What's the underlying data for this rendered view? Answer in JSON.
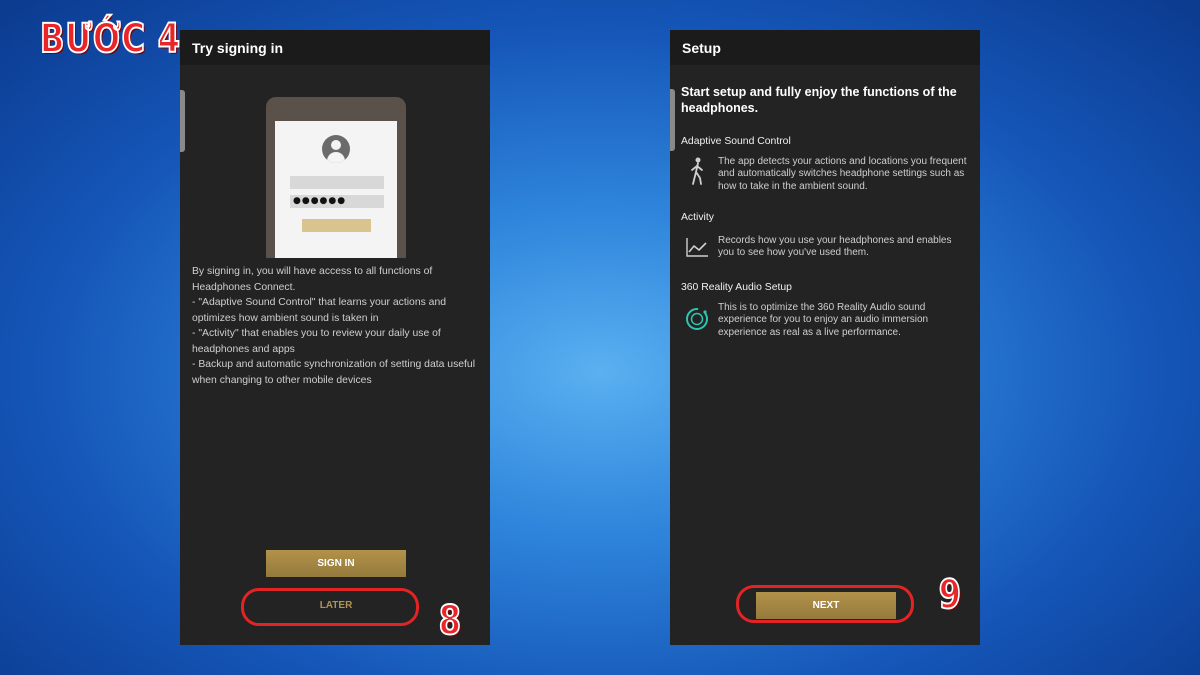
{
  "step_label": "BƯỚC 4",
  "badges": {
    "left": "8",
    "right": "9"
  },
  "left_screen": {
    "title": "Try signing in",
    "password_mask": "●●●●●●",
    "description": [
      "By signing in, you will have access to all functions of Headphones Connect.",
      "- \"Adaptive Sound Control\" that learns your actions and optimizes how ambient sound is taken in",
      "- \"Activity\" that enables you to review your daily use of headphones and apps",
      "- Backup and automatic synchronization of setting data useful when changing to other mobile devices"
    ],
    "sign_in_label": "SIGN IN",
    "later_label": "LATER"
  },
  "right_screen": {
    "title": "Setup",
    "heading": "Start setup and fully enjoy the functions of the headphones.",
    "sections": [
      {
        "title": "Adaptive Sound Control",
        "icon": "walking-person-icon",
        "text": "The app detects your actions and locations you frequent and automatically switches headphone settings such as how to take in the ambient sound."
      },
      {
        "title": "Activity",
        "icon": "line-chart-icon",
        "text": "Records how you use your headphones and enables you to see how you've used them."
      },
      {
        "title": "360 Reality Audio Setup",
        "icon": "360-audio-icon",
        "text": "This is to optimize the 360 Reality Audio sound experience for you to enjoy an audio immersion experience as real as a live performance."
      }
    ],
    "next_label": "NEXT"
  },
  "colors": {
    "accent_gold": "#a88a46",
    "highlight_red": "#e32424",
    "panel_bg": "#232323"
  }
}
